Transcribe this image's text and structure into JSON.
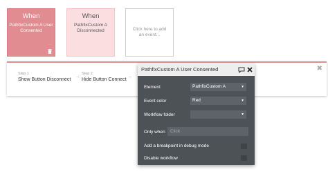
{
  "events": [
    {
      "when_label": "When",
      "text": "PathfixCustom A User Consented",
      "delete_icon": "trash-icon"
    },
    {
      "when_label": "When",
      "text": "PathfixCustom A Disconnected"
    },
    {
      "text": "Click here to add an event..."
    }
  ],
  "workflow": {
    "steps": [
      {
        "number": "Step 1",
        "label": "Show Button Disconnect"
      },
      {
        "number": "Step 2",
        "label": "Hide Button Connect"
      }
    ],
    "arrow_icon": "arrow-right-icon",
    "close_icon": "close-icon"
  },
  "panel": {
    "title": "PathfixCustom A User Consented",
    "comment_icon": "comment-icon",
    "close_icon": "close-icon",
    "element_label": "Element",
    "element_value": "PathfixCustom A",
    "color_label": "Event color",
    "color_value": "Red",
    "folder_label": "Workflow folder",
    "folder_value": "",
    "only_when_label": "Only when",
    "only_when_placeholder": "Click",
    "breakpoint_label": "Add a breakpoint in debug mode",
    "disable_label": "Disable workflow"
  },
  "colors": {
    "event_active": "#e08c90",
    "event_inactive": "#fbdfe0",
    "panel_bg": "#4d5257",
    "panel_header": "#eeeeee"
  }
}
